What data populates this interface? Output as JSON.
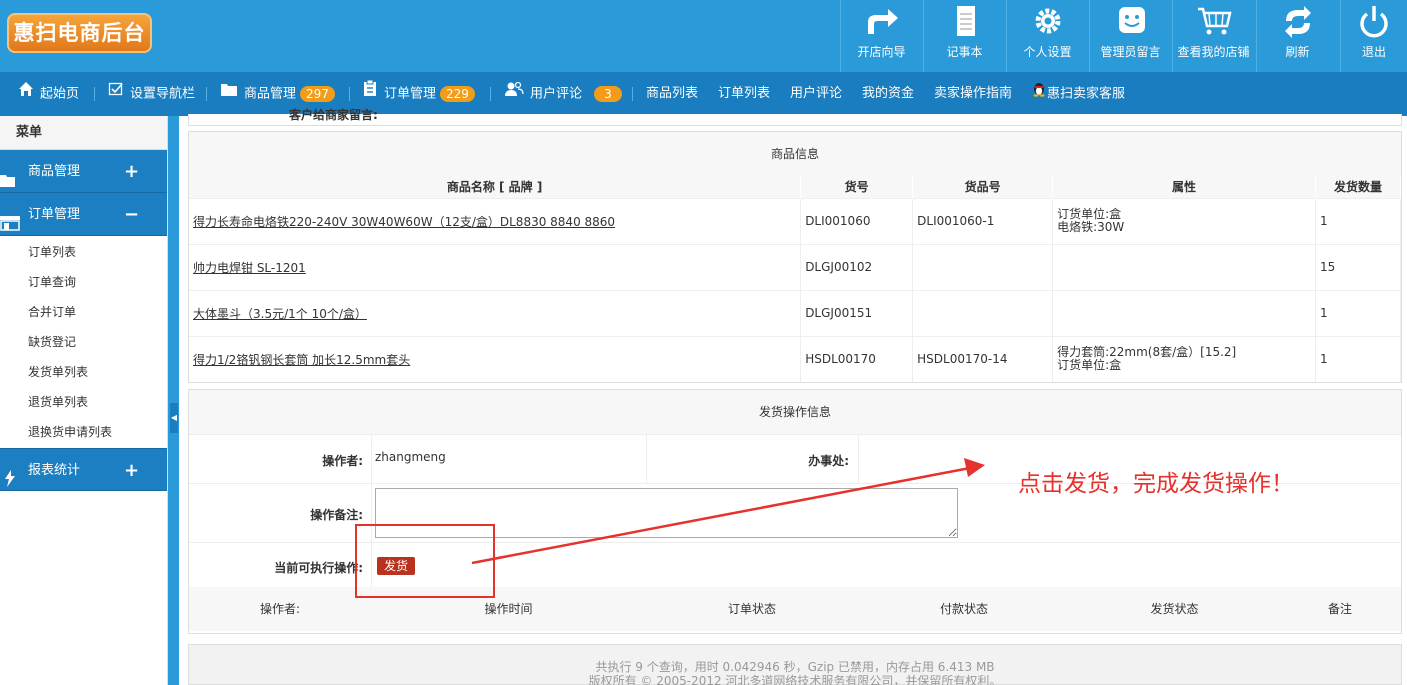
{
  "header": {
    "logo": "惠扫电商后台",
    "buttons": [
      {
        "label": "开店向导",
        "icon": "share-arrow-icon"
      },
      {
        "label": "记事本",
        "icon": "notepad-icon"
      },
      {
        "label": "个人设置",
        "icon": "gear-icon"
      },
      {
        "label": "管理员留言",
        "icon": "chat-smile-icon"
      },
      {
        "label": "查看我的店铺",
        "icon": "cart-icon"
      },
      {
        "label": "刷新",
        "icon": "refresh-icon"
      },
      {
        "label": "退出",
        "icon": "power-icon"
      }
    ]
  },
  "nav": {
    "items": [
      {
        "label": "起始页",
        "icon": "home-icon"
      },
      {
        "label": "设置导航栏",
        "icon": "checkbox-icon"
      },
      {
        "label": "商品管理",
        "icon": "folder-icon",
        "badge": "297"
      },
      {
        "label": "订单管理",
        "icon": "clipboard-icon",
        "badge": "229"
      },
      {
        "label": "用户评论",
        "icon": "users-icon",
        "badge": "3"
      },
      {
        "label": "商品列表"
      },
      {
        "label": "订单列表"
      },
      {
        "label": "用户评论"
      },
      {
        "label": "我的资金"
      },
      {
        "label": "卖家操作指南"
      },
      {
        "label": "惠扫卖家客服",
        "icon": "qq-penguin-icon"
      }
    ]
  },
  "sidebar": {
    "title": "菜单",
    "groups": [
      {
        "label": "商品管理",
        "toggle": "+"
      },
      {
        "label": "订单管理",
        "toggle": "−"
      },
      {
        "label": "报表统计",
        "toggle": "+"
      }
    ],
    "order_items": [
      "订单列表",
      "订单查询",
      "合并订单",
      "缺货登记",
      "发货单列表",
      "退货单列表",
      "退换货申请列表"
    ]
  },
  "partial_text": "客户给商家留言:",
  "products": {
    "title": "商品信息",
    "columns": [
      "商品名称 [ 品牌 ]",
      "货号",
      "货品号",
      "属性",
      "发货数量"
    ],
    "rows": [
      {
        "name": "得力长寿命电烙铁220-240V 30W40W60W（12支/盒）DL8830 8840 8860",
        "sku": "DLI001060",
        "item_no": "DLI001060-1",
        "attr1": "订货单位:盒",
        "attr2": "电烙铁:30W",
        "qty": "1"
      },
      {
        "name": "帅力电焊钳 SL-1201",
        "sku": "DLGJ00102",
        "item_no": "",
        "attr1": "",
        "attr2": "",
        "qty": "15"
      },
      {
        "name": "大体墨斗（3.5元/1个 10个/盒）",
        "sku": "DLGJ00151",
        "item_no": "",
        "attr1": "",
        "attr2": "",
        "qty": "1"
      },
      {
        "name": "得力1/2铬钒钢长套筒 加长12.5mm套头",
        "sku": "HSDL00170",
        "item_no": "HSDL00170-14",
        "attr1": "得力套筒:22mm(8套/盒）[15.2]",
        "attr2": "订货单位:盒",
        "qty": "1"
      }
    ]
  },
  "ship_op": {
    "title": "发货操作信息",
    "operator_label": "操作者:",
    "operator_value": "zhangmeng",
    "office_label": "办事处:",
    "office_value": "",
    "note_label": "操作备注:",
    "note_value": "",
    "action_label": "当前可执行操作:",
    "ship_button": "发货",
    "log_columns": [
      "操作者:",
      "操作时间",
      "订单状态",
      "付款状态",
      "发货状态",
      "备注"
    ]
  },
  "annotation": "点击发货，完成发货操作！",
  "footer": {
    "line1": "共执行 9 个查询，用时 0.042946 秒，Gzip 已禁用，内存占用 6.413 MB",
    "line2": "版权所有 © 2005-2012 河北多道网络技术服务有限公司，并保留所有权利。"
  },
  "colors": {
    "header_bg": "#2a9ad8",
    "nav_bg": "#1a7dbf",
    "badge": "#f39c19",
    "ship_button": "#b8321e",
    "annotation": "#e5322d"
  }
}
